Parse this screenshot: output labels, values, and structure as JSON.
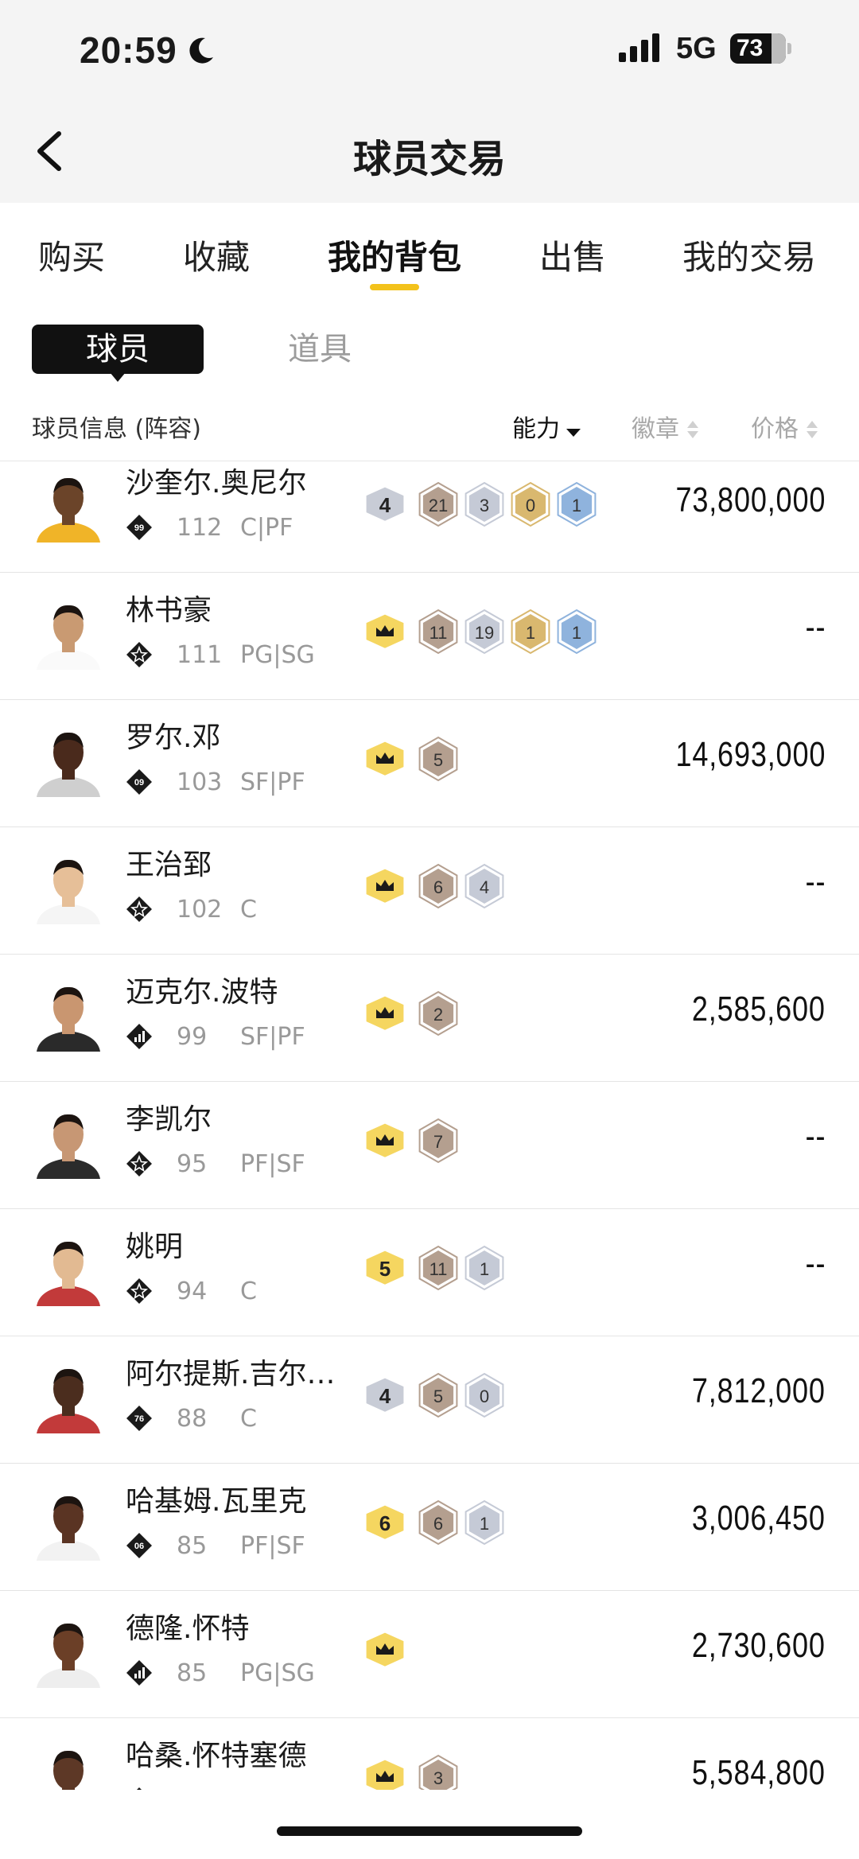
{
  "status": {
    "time": "20:59",
    "network": "5G",
    "battery": "73"
  },
  "nav": {
    "title": "球员交易"
  },
  "tabs": [
    "购买",
    "收藏",
    "我的背包",
    "出售",
    "我的交易"
  ],
  "active_tab": 2,
  "segment": {
    "player": "球员",
    "item": "道具"
  },
  "columns": {
    "info": "球员信息 (阵容)",
    "ability": "能力",
    "badge": "徽章",
    "price": "价格"
  },
  "colors": {
    "accent_yellow": "#f3c21b",
    "badge_gray": "#c8ccd6",
    "badge_bronze": "#b49f8f",
    "badge_silver": "#c5cad6",
    "badge_gold": "#d9b86f",
    "badge_blue": "#8fb3dd",
    "crown_yellow": "#f5d660"
  },
  "players": [
    {
      "name": "沙奎尔.奥尼尔",
      "rank_icon": "rank-99-icon",
      "rank_label": "99",
      "ovr": "112",
      "pos": "C|PF",
      "level": "4",
      "level_style": "gray",
      "badges": [
        {
          "v": "21",
          "c": "bronze"
        },
        {
          "v": "3",
          "c": "silver"
        },
        {
          "v": "0",
          "c": "gold"
        },
        {
          "v": "1",
          "c": "blue"
        }
      ],
      "price": "73,800,000"
    },
    {
      "name": "林书豪",
      "rank_icon": "star-rank-icon",
      "rank_label": "",
      "ovr": "111",
      "pos": "PG|SG",
      "level": "crown",
      "level_style": "crown",
      "badges": [
        {
          "v": "11",
          "c": "bronze"
        },
        {
          "v": "19",
          "c": "silver"
        },
        {
          "v": "1",
          "c": "gold"
        },
        {
          "v": "1",
          "c": "blue"
        }
      ],
      "price": "--"
    },
    {
      "name": "罗尔.邓",
      "rank_icon": "rank-09-icon",
      "rank_label": "09",
      "ovr": "103",
      "pos": "SF|PF",
      "level": "crown",
      "level_style": "crown",
      "badges": [
        {
          "v": "5",
          "c": "bronze"
        }
      ],
      "price": "14,693,000"
    },
    {
      "name": "王治郅",
      "rank_icon": "star-rank-icon",
      "rank_label": "",
      "ovr": "102",
      "pos": "C",
      "level": "crown",
      "level_style": "crown",
      "badges": [
        {
          "v": "6",
          "c": "bronze"
        },
        {
          "v": "4",
          "c": "silver"
        }
      ],
      "price": "--"
    },
    {
      "name": "迈克尔.波特",
      "rank_icon": "bars-rank-icon",
      "rank_label": "",
      "ovr": "99",
      "pos": "SF|PF",
      "level": "crown",
      "level_style": "crown",
      "badges": [
        {
          "v": "2",
          "c": "bronze"
        }
      ],
      "price": "2,585,600"
    },
    {
      "name": "李凯尔",
      "rank_icon": "star-rank-icon",
      "rank_label": "",
      "ovr": "95",
      "pos": "PF|SF",
      "level": "crown",
      "level_style": "crown",
      "badges": [
        {
          "v": "7",
          "c": "bronze"
        }
      ],
      "price": "--"
    },
    {
      "name": "姚明",
      "rank_icon": "star-rank-icon",
      "rank_label": "",
      "ovr": "94",
      "pos": "C",
      "level": "5",
      "level_style": "yellow",
      "badges": [
        {
          "v": "11",
          "c": "bronze"
        },
        {
          "v": "1",
          "c": "silver"
        }
      ],
      "price": "--"
    },
    {
      "name": "阿尔提斯.吉尔…",
      "rank_icon": "rank-76-icon",
      "rank_label": "76",
      "ovr": "88",
      "pos": "C",
      "level": "4",
      "level_style": "gray",
      "badges": [
        {
          "v": "5",
          "c": "bronze"
        },
        {
          "v": "0",
          "c": "silver"
        }
      ],
      "price": "7,812,000"
    },
    {
      "name": "哈基姆.瓦里克",
      "rank_icon": "rank-06-icon",
      "rank_label": "06",
      "ovr": "85",
      "pos": "PF|SF",
      "level": "6",
      "level_style": "yellow",
      "badges": [
        {
          "v": "6",
          "c": "bronze"
        },
        {
          "v": "1",
          "c": "silver"
        }
      ],
      "price": "3,006,450"
    },
    {
      "name": "德隆.怀特",
      "rank_icon": "bars-rank-icon",
      "rank_label": "",
      "ovr": "85",
      "pos": "PG|SG",
      "level": "crown",
      "level_style": "crown",
      "badges": [],
      "price": "2,730,600"
    },
    {
      "name": "哈桑.怀特塞德",
      "rank_icon": "star-rank-icon",
      "rank_label": "",
      "ovr": "",
      "pos": "",
      "level": "crown",
      "level_style": "crown",
      "badges": [
        {
          "v": "3",
          "c": "bronze"
        }
      ],
      "price": "5,584,800"
    }
  ]
}
